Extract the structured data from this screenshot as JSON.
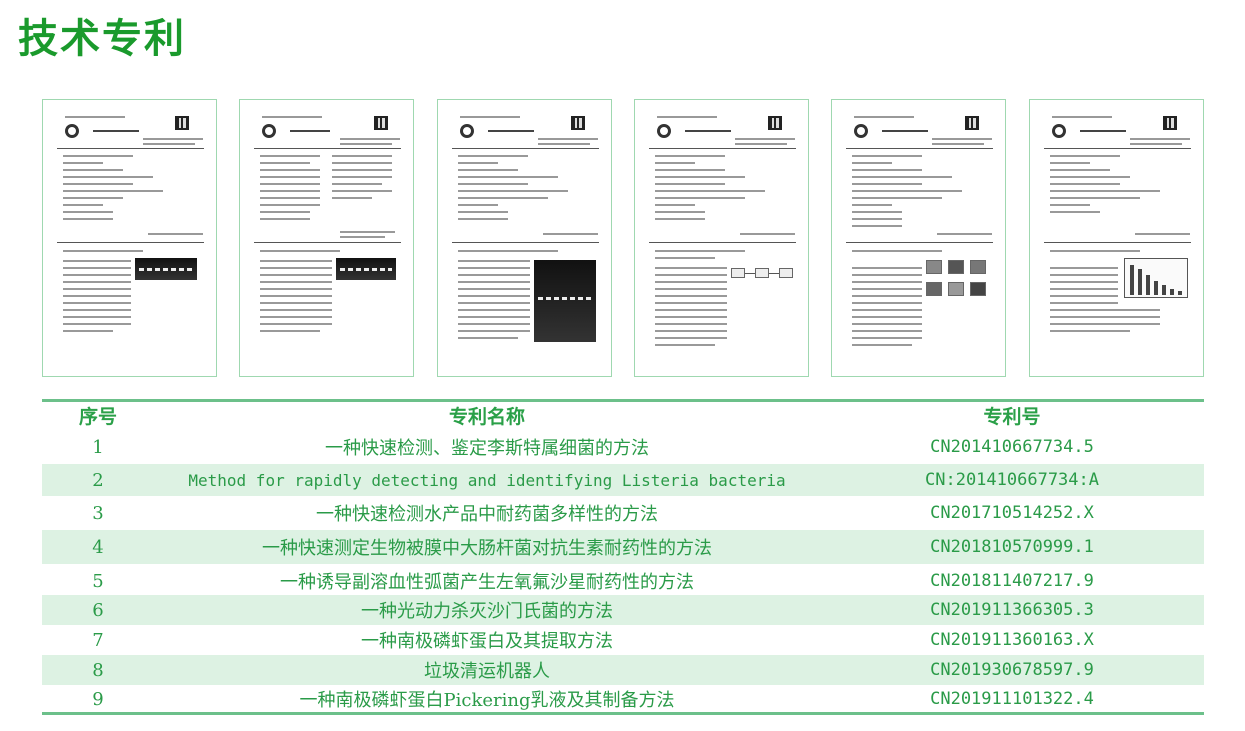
{
  "title": "技术专利",
  "thumbnails": [
    {
      "type": "application"
    },
    {
      "type": "grant"
    },
    {
      "type": "application"
    },
    {
      "type": "application"
    },
    {
      "type": "application"
    },
    {
      "type": "application"
    }
  ],
  "table": {
    "headers": {
      "index": "序号",
      "name": "专利名称",
      "number": "专利号"
    },
    "rows": [
      {
        "index": "1",
        "name": "一种快速检测、鉴定李斯特属细菌的方法",
        "number": "CN201410667734.5"
      },
      {
        "index": "2",
        "name": "Method for rapidly detecting and identifying Listeria bacteria",
        "number": "CN:201410667734:A"
      },
      {
        "index": "3",
        "name": "一种快速检测水产品中耐药菌多样性的方法",
        "number": "CN201710514252.X"
      },
      {
        "index": "4",
        "name": "一种快速测定生物被膜中大肠杆菌对抗生素耐药性的方法",
        "number": "CN201810570999.1"
      },
      {
        "index": "5",
        "name": "一种诱导副溶血性弧菌产生左氧氟沙星耐药性的方法",
        "number": "CN201811407217.9"
      },
      {
        "index": "6",
        "name": "一种光动力杀灭沙门氏菌的方法",
        "number": "CN201911366305.3"
      },
      {
        "index": "7",
        "name": "一种南极磷虾蛋白及其提取方法",
        "number": "CN201911360163.X"
      },
      {
        "index": "8",
        "name": "垃圾清运机器人",
        "number": "CN201930678597.9"
      },
      {
        "index": "9",
        "name": "一种南极磷虾蛋白Pickering乳液及其制备方法",
        "number": "CN201911101322.4"
      }
    ]
  },
  "colors": {
    "accent": "#1a9a2c",
    "row_alt": "#ddf2e3",
    "rule": "#6cc08a"
  }
}
